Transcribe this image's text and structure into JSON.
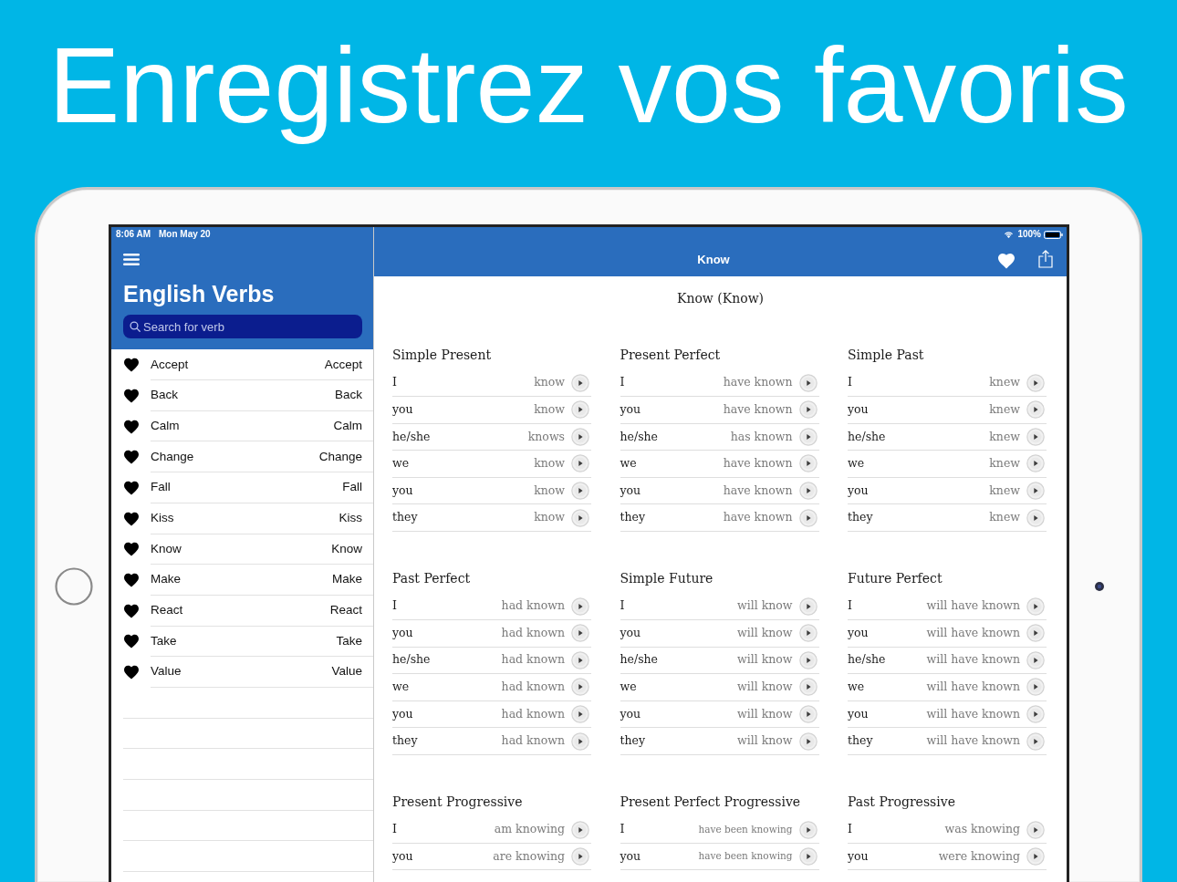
{
  "headline": "Enregistrez vos favoris",
  "status_bar": {
    "time": "8:06 AM",
    "date": "Mon May 20",
    "battery": "100%"
  },
  "sidebar": {
    "title": "English Verbs",
    "search": {
      "placeholder": "Search for verb"
    },
    "items": [
      {
        "verb": "Accept",
        "translation": "Accept",
        "favorite": true
      },
      {
        "verb": "Back",
        "translation": "Back",
        "favorite": true
      },
      {
        "verb": "Calm",
        "translation": "Calm",
        "favorite": true
      },
      {
        "verb": "Change",
        "translation": "Change",
        "favorite": true
      },
      {
        "verb": "Fall",
        "translation": "Fall",
        "favorite": true
      },
      {
        "verb": "Kiss",
        "translation": "Kiss",
        "favorite": true
      },
      {
        "verb": "Know",
        "translation": "Know",
        "favorite": true
      },
      {
        "verb": "Make",
        "translation": "Make",
        "favorite": true
      },
      {
        "verb": "React",
        "translation": "React",
        "favorite": true
      },
      {
        "verb": "Take",
        "translation": "Take",
        "favorite": true
      },
      {
        "verb": "Value",
        "translation": "Value",
        "favorite": true
      }
    ]
  },
  "nav_bar": {
    "title": "Know",
    "favorite": true
  },
  "content": {
    "title": "Know (Know)",
    "tenses": [
      {
        "name": "Simple Present",
        "rows": [
          {
            "pronoun": "I",
            "form": "know"
          },
          {
            "pronoun": "you",
            "form": "know"
          },
          {
            "pronoun": "he/she",
            "form": "knows"
          },
          {
            "pronoun": "we",
            "form": "know"
          },
          {
            "pronoun": "you",
            "form": "know"
          },
          {
            "pronoun": "they",
            "form": "know"
          }
        ]
      },
      {
        "name": "Present Perfect",
        "rows": [
          {
            "pronoun": "I",
            "form": "have known"
          },
          {
            "pronoun": "you",
            "form": "have known"
          },
          {
            "pronoun": "he/she",
            "form": "has known"
          },
          {
            "pronoun": "we",
            "form": "have known"
          },
          {
            "pronoun": "you",
            "form": "have known"
          },
          {
            "pronoun": "they",
            "form": "have known"
          }
        ]
      },
      {
        "name": "Simple Past",
        "rows": [
          {
            "pronoun": "I",
            "form": "knew"
          },
          {
            "pronoun": "you",
            "form": "knew"
          },
          {
            "pronoun": "he/she",
            "form": "knew"
          },
          {
            "pronoun": "we",
            "form": "knew"
          },
          {
            "pronoun": "you",
            "form": "knew"
          },
          {
            "pronoun": "they",
            "form": "knew"
          }
        ]
      },
      {
        "name": "Past Perfect",
        "rows": [
          {
            "pronoun": "I",
            "form": "had known"
          },
          {
            "pronoun": "you",
            "form": "had known"
          },
          {
            "pronoun": "he/she",
            "form": "had known"
          },
          {
            "pronoun": "we",
            "form": "had known"
          },
          {
            "pronoun": "you",
            "form": "had known"
          },
          {
            "pronoun": "they",
            "form": "had known"
          }
        ]
      },
      {
        "name": "Simple Future",
        "rows": [
          {
            "pronoun": "I",
            "form": "will know"
          },
          {
            "pronoun": "you",
            "form": "will know"
          },
          {
            "pronoun": "he/she",
            "form": "will know"
          },
          {
            "pronoun": "we",
            "form": "will know"
          },
          {
            "pronoun": "you",
            "form": "will know"
          },
          {
            "pronoun": "they",
            "form": "will know"
          }
        ]
      },
      {
        "name": "Future Perfect",
        "rows": [
          {
            "pronoun": "I",
            "form": "will have known"
          },
          {
            "pronoun": "you",
            "form": "will have known"
          },
          {
            "pronoun": "he/she",
            "form": "will have known"
          },
          {
            "pronoun": "we",
            "form": "will have known"
          },
          {
            "pronoun": "you",
            "form": "will have known"
          },
          {
            "pronoun": "they",
            "form": "will have known"
          }
        ]
      },
      {
        "name": "Present Progressive",
        "rows": [
          {
            "pronoun": "I",
            "form": "am knowing"
          },
          {
            "pronoun": "you",
            "form": "are knowing"
          }
        ]
      },
      {
        "name": "Present Perfect Progressive",
        "rows": [
          {
            "pronoun": "I",
            "form": "have been knowing"
          },
          {
            "pronoun": "you",
            "form": "have been knowing"
          }
        ]
      },
      {
        "name": "Past Progressive",
        "rows": [
          {
            "pronoun": "I",
            "form": "was knowing"
          },
          {
            "pronoun": "you",
            "form": "were knowing"
          }
        ]
      }
    ]
  }
}
